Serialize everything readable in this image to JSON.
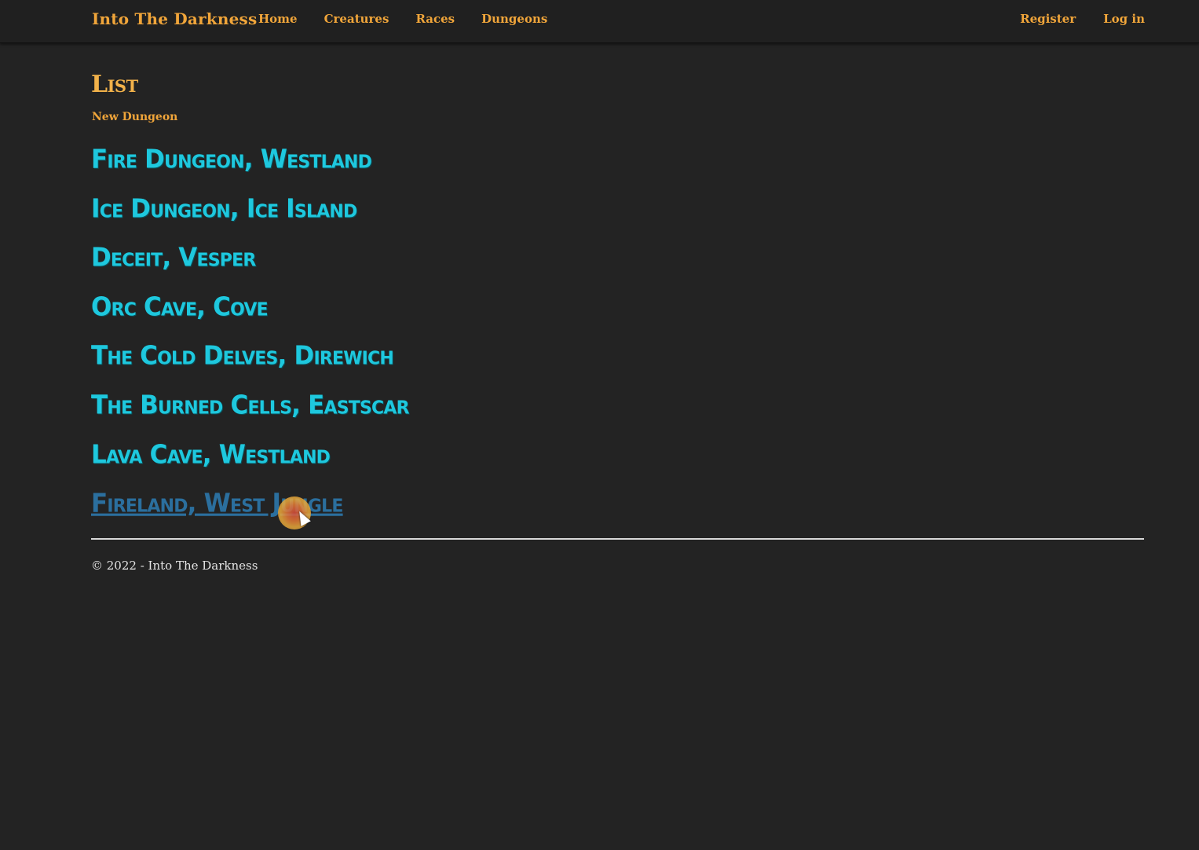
{
  "navbar": {
    "brand": "Into The Darkness",
    "links": [
      "Home",
      "Creatures",
      "Races",
      "Dungeons"
    ],
    "account_links": [
      "Register",
      "Log in"
    ]
  },
  "main": {
    "title": "List",
    "new_link": "New Dungeon",
    "dungeons": [
      "Fire Dungeon, Westland",
      "Ice Dungeon, Ice Island",
      "Deceit, Vesper",
      "Orc Cave, Cove",
      "The Cold Delves, Direwich",
      "The Burned Cells, Eastscar",
      "Lava Cave, Westland",
      "Fireland, West Jungle"
    ]
  },
  "footer": {
    "text": "© 2022 - Into The Darkness"
  },
  "colors": {
    "background": "#232323",
    "accent": "#f0a53a",
    "link": "#1ec8de",
    "link_hover": "#2b6f9e"
  }
}
